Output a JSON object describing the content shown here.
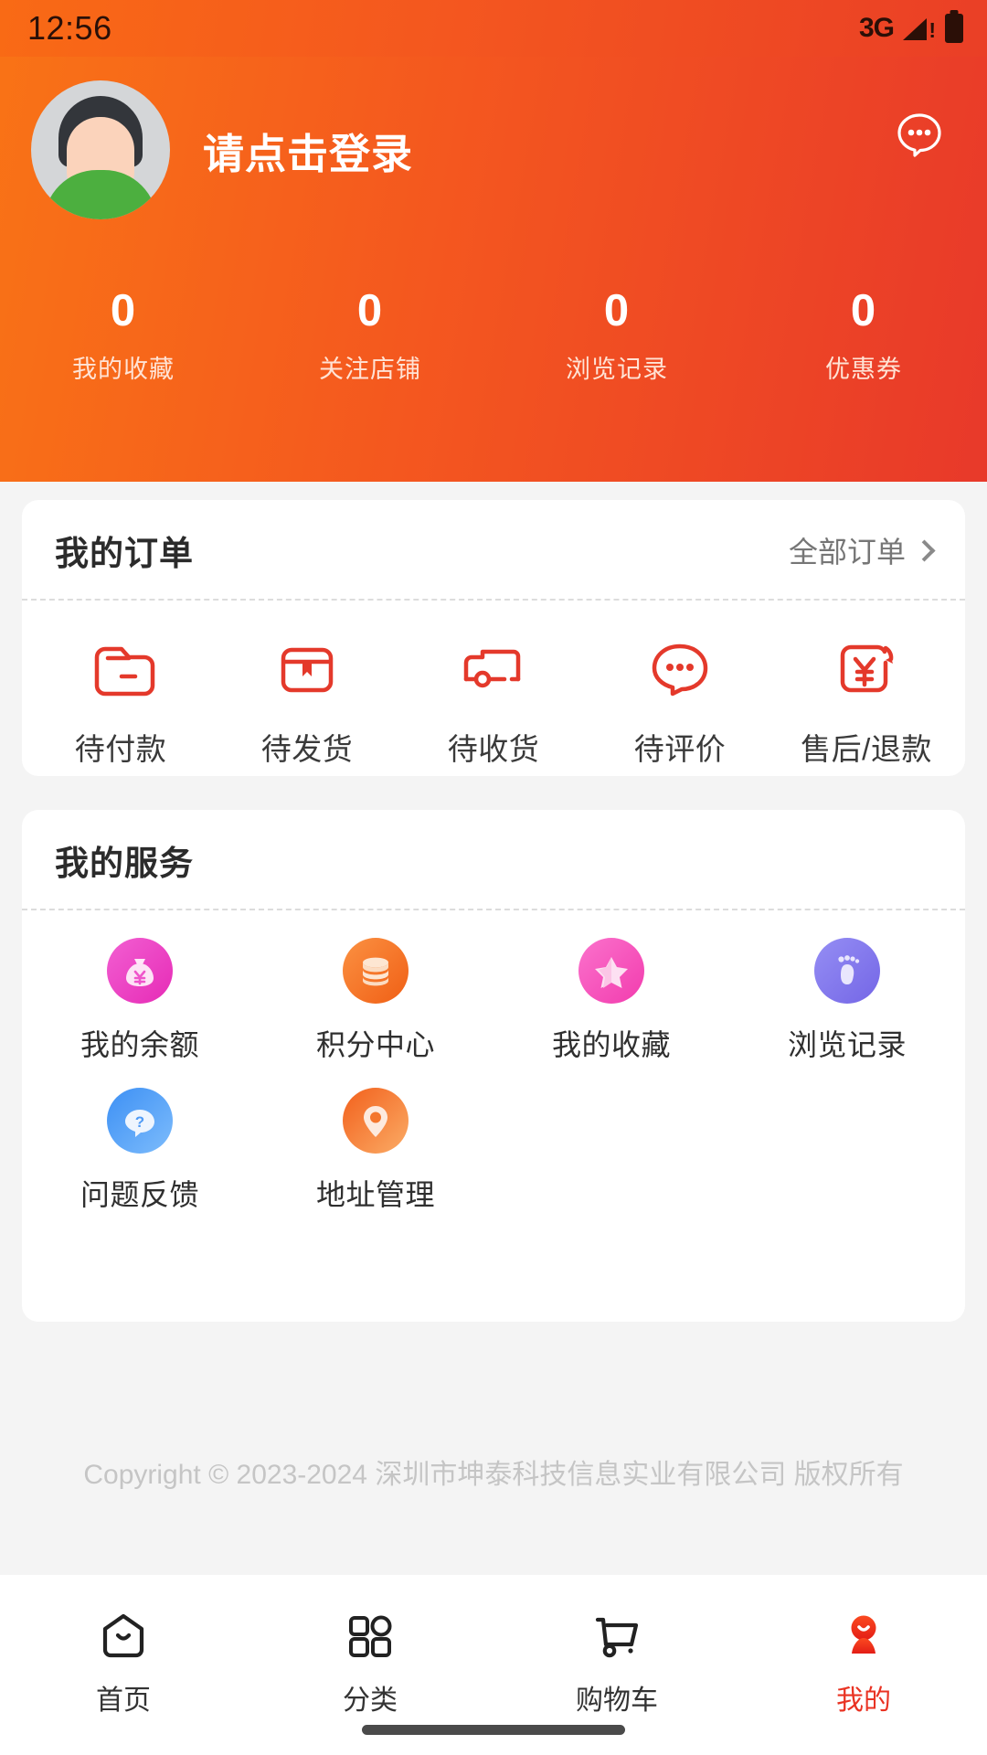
{
  "status_bar": {
    "time": "12:56",
    "network": "3G",
    "signal_icon": "signal-warning-icon",
    "battery_icon": "battery-full-icon"
  },
  "header": {
    "avatar_icon": "default-user-avatar",
    "login_text": "请点击登录",
    "chat_icon": "chat-bubble-icon",
    "accent_gradient_from": "#f97316",
    "accent_gradient_to": "#e8392a",
    "stats": [
      {
        "value": "0",
        "label": "我的收藏"
      },
      {
        "value": "0",
        "label": "关注店铺"
      },
      {
        "value": "0",
        "label": "浏览记录"
      },
      {
        "value": "0",
        "label": "优惠券"
      }
    ]
  },
  "orders_card": {
    "title": "我的订单",
    "more_label": "全部订单",
    "more_icon": "chevron-right-icon",
    "items": [
      {
        "label": "待付款",
        "icon": "wallet-icon",
        "color": "#e4392b"
      },
      {
        "label": "待发货",
        "icon": "package-box-icon",
        "color": "#e4392b"
      },
      {
        "label": "待收货",
        "icon": "delivery-truck-icon",
        "color": "#e4392b"
      },
      {
        "label": "待评价",
        "icon": "comment-dots-icon",
        "color": "#e4392b"
      },
      {
        "label": "售后/退款",
        "icon": "yen-refund-icon",
        "color": "#e4392b"
      }
    ]
  },
  "services_card": {
    "title": "我的服务",
    "items": [
      {
        "label": "我的余额",
        "icon": "money-bag-icon",
        "color_from": "#f04ec9",
        "color_to": "#e92fb9"
      },
      {
        "label": "积分中心",
        "icon": "coins-stack-icon",
        "color_from": "#fb8b3c",
        "color_to": "#f2681c"
      },
      {
        "label": "我的收藏",
        "icon": "star-icon",
        "color_from": "#fa62c4",
        "color_to": "#f23fb0"
      },
      {
        "label": "浏览记录",
        "icon": "footprint-icon",
        "color_from": "#8a7df0",
        "color_to": "#7a6cea"
      },
      {
        "label": "问题反馈",
        "icon": "question-bubble-icon",
        "color_from": "#3f94f5",
        "color_to": "#79b9fb"
      },
      {
        "label": "地址管理",
        "icon": "location-pin-icon",
        "color_from": "#f2601c",
        "color_to": "#fba861"
      }
    ]
  },
  "footer": {
    "copyright": "Copyright © 2023-2024 深圳市坤泰科技信息实业有限公司 版权所有"
  },
  "bottom_nav": {
    "active_color": "#e93323",
    "items": [
      {
        "label": "首页",
        "icon": "home-icon",
        "active": false
      },
      {
        "label": "分类",
        "icon": "grid-category-icon",
        "active": false
      },
      {
        "label": "购物车",
        "icon": "shopping-cart-icon",
        "active": false
      },
      {
        "label": "我的",
        "icon": "user-profile-icon",
        "active": true
      }
    ]
  }
}
